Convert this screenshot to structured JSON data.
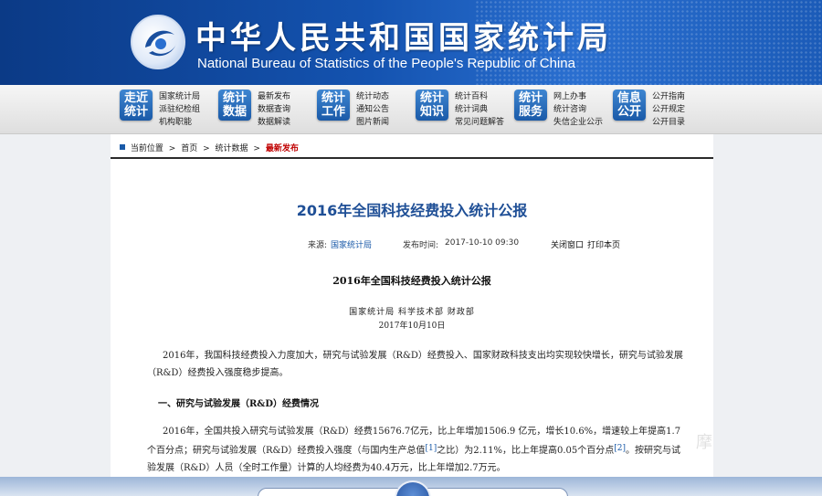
{
  "header": {
    "title_cn": "中华人民共和国国家统计局",
    "title_en": "National Bureau of Statistics of the People's Republic of China"
  },
  "nav": [
    {
      "badge": [
        "走近",
        "统计"
      ],
      "links": [
        "国家统计局",
        "派驻纪检组",
        "机构职能"
      ]
    },
    {
      "badge": [
        "统计",
        "数据"
      ],
      "links": [
        "最新发布",
        "数据查询",
        "数据解读"
      ]
    },
    {
      "badge": [
        "统计",
        "工作"
      ],
      "links": [
        "统计动态",
        "通知公告",
        "图片新闻"
      ]
    },
    {
      "badge": [
        "统计",
        "知识"
      ],
      "links": [
        "统计百科",
        "统计词典",
        "常见问题解答"
      ]
    },
    {
      "badge": [
        "统计",
        "服务"
      ],
      "links": [
        "网上办事",
        "统计咨询",
        "失信企业公示"
      ]
    },
    {
      "badge": [
        "信息",
        "公开"
      ],
      "links": [
        "公开指南",
        "公开规定",
        "公开目录"
      ]
    }
  ],
  "breadcrumb": {
    "label": "当前位置",
    "items": [
      "首页",
      "统计数据"
    ],
    "current": "最新发布",
    "sep": ">"
  },
  "article": {
    "title": "2016年全国科技经费投入统计公报",
    "source_label": "来源:",
    "source_value": "国家统计局",
    "time_label": "发布时间:",
    "time_value": "2017-10-10 09:30",
    "close_label": "关闭窗口",
    "print_label": "打印本页",
    "sub_title": "2016年全国科技经费投入统计公报",
    "issuers": "国家统计局  科学技术部  财政部",
    "date": "2017年10月10日",
    "para1": "2016年，我国科技经费投入力度加大，研究与试验发展（R&D）经费投入、国家财政科技支出均实现较快增长，研究与试验发展（R&D）经费投入强度稳步提高。",
    "heading1": "一、研究与试验发展（R&D）经费情况",
    "para2_a": "2016年，全国共投入研究与试验发展（R&D）经费15676.7亿元，比上年增加1506.9 亿元，增长10.6%，增速较上年提高1.7个百分点；研究与试验发展（R&D）经费投入强度（与国内生产总值",
    "fn1": "[1]",
    "para2_b": "之比）为2.11%，比上年提高0.05个百分点",
    "fn2": "[2]",
    "para2_c": "。按研究与试验发展（R&D）人员（全时工作量）计算的人均经费为40.4万元，比上年增加2.7万元。"
  },
  "watermark": "摩"
}
